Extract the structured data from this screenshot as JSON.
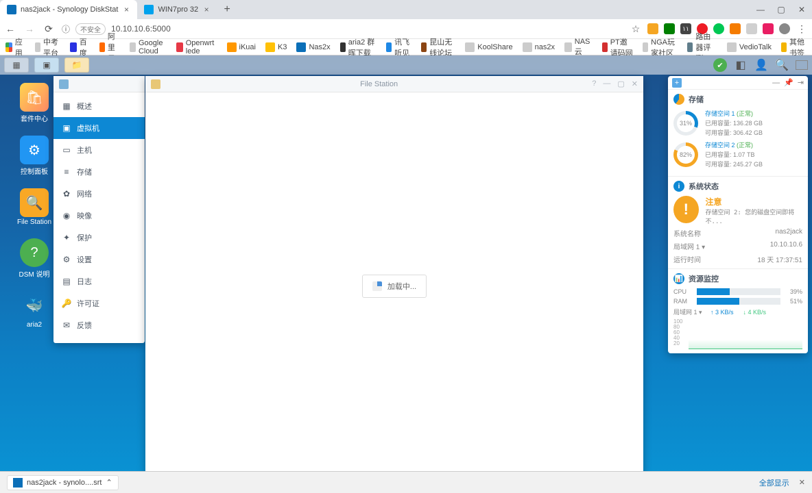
{
  "browser": {
    "tabs": [
      {
        "title": "nas2jack - Synology DiskStat",
        "active": true
      },
      {
        "title": "WIN7pro 32",
        "active": false
      }
    ],
    "address": "10.10.10.6:5000",
    "security_label": "不安全",
    "info_icon": "ⓘ",
    "bookmarks": [
      "应用",
      "中考平台",
      "百度",
      "阿里云",
      "Google Cloud",
      "Openwrt lede",
      "iKuai",
      "K3",
      "Nas2x",
      "aria2 群晖下载",
      "讯飞听见",
      "昆山无线论坛",
      "KoolShare",
      "nas2x",
      "NAS云",
      "PT邀请码网",
      "NGA玩家社区",
      "路由器评测",
      "VedioTalk"
    ],
    "other_bm": "其他书签",
    "ext_colors": [
      "#f5a623",
      "#008000",
      "#00bcd4",
      "#109b10",
      "#ee1c25",
      "#00b894",
      "#00c853",
      "#f57c00",
      "#d0d0d0",
      "#e91e63"
    ]
  },
  "desktop_icons": [
    {
      "label": "套件中心",
      "bg": "linear-gradient(135deg,#ffd54f,#ff8a65)",
      "glyph": "🛍"
    },
    {
      "label": "控制面板",
      "bg": "#2196f3",
      "glyph": "⚙"
    },
    {
      "label": "File Station",
      "bg": "#f9a825",
      "glyph": "🔍"
    },
    {
      "label": "DSM 说明",
      "bg": "#4caf50",
      "glyph": "?"
    },
    {
      "label": "aria2",
      "bg": "#1b4f8a",
      "glyph": "🐳"
    }
  ],
  "vmm": {
    "items": [
      {
        "icon": "▦",
        "label": "概述"
      },
      {
        "icon": "▣",
        "label": "虚拟机",
        "active": true
      },
      {
        "icon": "▭",
        "label": "主机"
      },
      {
        "icon": "≡",
        "label": "存储"
      },
      {
        "icon": "✿",
        "label": "网络"
      },
      {
        "icon": "◉",
        "label": "映像"
      },
      {
        "icon": "✦",
        "label": "保护"
      },
      {
        "icon": "⚙",
        "label": "设置"
      },
      {
        "icon": "▤",
        "label": "日志"
      },
      {
        "icon": "🔑",
        "label": "许可证"
      },
      {
        "icon": "✉",
        "label": "反馈"
      }
    ]
  },
  "file_station": {
    "title": "File Station",
    "loading": "加载中..."
  },
  "dashboard": {
    "storage": {
      "title": "存储",
      "volumes": [
        {
          "name": "存储空间 1",
          "status": "(正常)",
          "used_label": "已用容量:",
          "used": "136.28 GB",
          "avail_label": "可用容量:",
          "avail": "306.42 GB",
          "pct": "31%"
        },
        {
          "name": "存储空间 2",
          "status": "(正常)",
          "used_label": "已用容量:",
          "used": "1.07 TB",
          "avail_label": "可用容量:",
          "avail": "245.27 GB",
          "pct": "82%"
        }
      ]
    },
    "health": {
      "title": "系统状态",
      "attn": "注意",
      "msg": "存储空间 2:  您的磁盘空间即将不...",
      "rows": [
        {
          "k": "系统名称",
          "v": "nas2jack"
        },
        {
          "k": "局域网 1 ▾",
          "v": "10.10.10.6"
        },
        {
          "k": "运行时间",
          "v": "18 天 17:37:51"
        }
      ]
    },
    "resource": {
      "title": "资源监控",
      "cpu": {
        "label": "CPU",
        "pct": 39,
        "text": "39%"
      },
      "ram": {
        "label": "RAM",
        "pct": 51,
        "text": "51%"
      },
      "lan": {
        "label": "局域网 1 ▾",
        "up": "↑ 3 KB/s",
        "down": "↓ 4 KB/s"
      },
      "ticks": [
        "100",
        "80",
        "60",
        "40",
        "20"
      ]
    }
  },
  "download": {
    "file": "nas2jack - synolo....srt",
    "show_all": "全部显示"
  }
}
